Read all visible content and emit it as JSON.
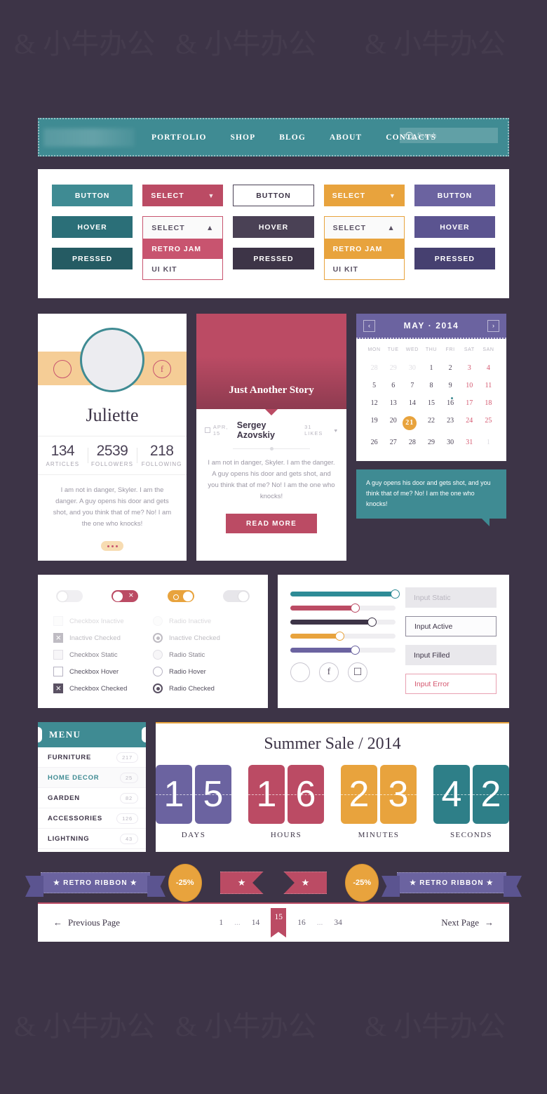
{
  "colors": {
    "bg": "#3d3447",
    "teal": "#3f8b93",
    "teal_hover": "#2b6f78",
    "teal_pressed": "#255b63",
    "crimson": "#bb4b64",
    "crimson_hover": "#c8546f",
    "orange": "#e8a33d",
    "purple": "#6b63a0",
    "dark": "#3d3447"
  },
  "nav": {
    "logo_alt": "site-logo",
    "links": [
      "PORTFOLIO",
      "SHOP",
      "BLOG",
      "ABOUT",
      "CONTACTS"
    ],
    "search_placeholder": "Search"
  },
  "buttons": {
    "columns": [
      {
        "type": "solid",
        "color": "teal",
        "items": [
          "BUTTON",
          "HOVER",
          "PRESSED"
        ]
      },
      {
        "type": "select",
        "color": "crimson",
        "closed_label": "SELECT",
        "open_label": "SELECT",
        "options": [
          "RETRO JAM",
          "UI KIT"
        ]
      },
      {
        "type": "solid",
        "color": "dark",
        "items": [
          "BUTTON",
          "HOVER",
          "PRESSED"
        ]
      },
      {
        "type": "select",
        "color": "orange",
        "closed_label": "SELECT",
        "open_label": "SELECT",
        "options": [
          "RETRO JAM",
          "UI KIT"
        ]
      },
      {
        "type": "solid",
        "color": "purple",
        "items": [
          "BUTTON",
          "HOVER",
          "PRESSED"
        ]
      }
    ]
  },
  "profile": {
    "name": "Juliette",
    "social": [
      "twitter-icon",
      "facebook-icon"
    ],
    "stats": [
      {
        "value": "134",
        "label": "ARTICLES"
      },
      {
        "value": "2539",
        "label": "FOLLOWERS"
      },
      {
        "value": "218",
        "label": "FOLLOWING"
      }
    ],
    "bio": "I am not in danger, Skyler. I am the danger. A guy opens his door and gets shot, and you think that of me? No! I am the one who knocks!"
  },
  "story": {
    "title": "Just Another Story",
    "date": "APR, 15",
    "author": "Sergey Azovskiy",
    "likes": "31 LIKES",
    "text": "I am not in danger, Skyler. I am the danger. A guy opens his door and gets shot, and you think that of me? No! I am the one who knocks!",
    "cta": "READ MORE"
  },
  "calendar": {
    "month": "MAY",
    "separator": "·",
    "year": "2014",
    "prev": "‹",
    "next": "›",
    "dow": [
      "MON",
      "TUE",
      "WED",
      "THU",
      "FRI",
      "SAT",
      "SAN"
    ],
    "weeks": [
      [
        {
          "d": "28",
          "s": "mut"
        },
        {
          "d": "29",
          "s": "mut"
        },
        {
          "d": "30",
          "s": "mut"
        },
        {
          "d": "1",
          "s": ""
        },
        {
          "d": "2",
          "s": ""
        },
        {
          "d": "3",
          "s": "wknd"
        },
        {
          "d": "4",
          "s": "wknd"
        }
      ],
      [
        {
          "d": "5",
          "s": ""
        },
        {
          "d": "6",
          "s": ""
        },
        {
          "d": "7",
          "s": ""
        },
        {
          "d": "8",
          "s": ""
        },
        {
          "d": "9",
          "s": ""
        },
        {
          "d": "10",
          "s": "wknd"
        },
        {
          "d": "11",
          "s": "wknd"
        }
      ],
      [
        {
          "d": "12",
          "s": ""
        },
        {
          "d": "13",
          "s": ""
        },
        {
          "d": "14",
          "s": ""
        },
        {
          "d": "15",
          "s": ""
        },
        {
          "d": "16",
          "s": "dot"
        },
        {
          "d": "17",
          "s": "wknd"
        },
        {
          "d": "18",
          "s": "wknd"
        }
      ],
      [
        {
          "d": "19",
          "s": ""
        },
        {
          "d": "20",
          "s": ""
        },
        {
          "d": "21",
          "s": "sel"
        },
        {
          "d": "22",
          "s": ""
        },
        {
          "d": "23",
          "s": ""
        },
        {
          "d": "24",
          "s": "wknd"
        },
        {
          "d": "25",
          "s": "wknd"
        }
      ],
      [
        {
          "d": "26",
          "s": ""
        },
        {
          "d": "27",
          "s": ""
        },
        {
          "d": "28",
          "s": ""
        },
        {
          "d": "29",
          "s": ""
        },
        {
          "d": "30",
          "s": ""
        },
        {
          "d": "31",
          "s": "wknd"
        },
        {
          "d": "1",
          "s": "mut"
        }
      ]
    ],
    "tooltip": "A guy opens his door and gets shot, and you think that of me? No! I am the one who knocks!"
  },
  "controls": {
    "toggles": [
      {
        "name": "toggle-off-light",
        "state": "off"
      },
      {
        "name": "toggle-on-red",
        "state": "on"
      },
      {
        "name": "toggle-on-orange",
        "state": "on"
      },
      {
        "name": "toggle-off-grey",
        "state": "off"
      }
    ],
    "checkboxes": [
      "Checkbox Inactive",
      "Inactive Checked",
      "Checkbox Static",
      "Checkbox Hover",
      "Checkbox Checked"
    ],
    "radios": [
      "Radio Inactive",
      "Inactive Checked",
      "Radio Static",
      "Radio Hover",
      "Radio Checked"
    ],
    "sliders": [
      {
        "color": "#2e8b96",
        "pct": 100
      },
      {
        "color": "#bb4b64",
        "pct": 62
      },
      {
        "color": "#3d3447",
        "pct": 78
      },
      {
        "color": "#e8a33d",
        "pct": 47
      },
      {
        "color": "#6b63a0",
        "pct": 62
      }
    ],
    "social_icons": [
      "twitter-icon",
      "facebook-icon",
      "instagram-icon"
    ],
    "inputs": [
      {
        "state": "static",
        "value": "Input Static"
      },
      {
        "state": "active",
        "value": "Input Active"
      },
      {
        "state": "filled",
        "value": "Input Filled"
      },
      {
        "state": "error",
        "value": "Input Error"
      }
    ]
  },
  "menu": {
    "title": "MENU",
    "items": [
      {
        "label": "FURNITURE",
        "count": "217",
        "active": false
      },
      {
        "label": "HOME DECOR",
        "count": "25",
        "active": true
      },
      {
        "label": "GARDEN",
        "count": "82",
        "active": false
      },
      {
        "label": "ACCESSORIES",
        "count": "126",
        "active": false
      },
      {
        "label": "LIGHTNING",
        "count": "43",
        "active": false
      }
    ]
  },
  "countdown": {
    "title": "Summer Sale / 2014",
    "groups": [
      {
        "label": "DAYS",
        "digits": [
          "1",
          "5"
        ],
        "color": "#6b63a0"
      },
      {
        "label": "HOURS",
        "digits": [
          "1",
          "6"
        ],
        "color": "#bb4b64"
      },
      {
        "label": "MINUTES",
        "digits": [
          "2",
          "3"
        ],
        "color": "#e8a33d"
      },
      {
        "label": "SECONDS",
        "digits": [
          "4",
          "2"
        ],
        "color": "#2e7f88"
      }
    ]
  },
  "ribbons": {
    "left_ribbon": "★  RETRO RIBBON  ★",
    "badge_left": "-25%",
    "flag_right_star": "★",
    "flag_left_star": "★",
    "badge_right": "-25%",
    "right_ribbon": "★  RETRO RIBBON  ★"
  },
  "pagination": {
    "prev": "Previous Page",
    "prev_arrow": "←",
    "next": "Next Page",
    "next_arrow": "→",
    "pages": [
      "1",
      "...",
      "14",
      "15",
      "16",
      "...",
      "34"
    ],
    "current": "15"
  }
}
